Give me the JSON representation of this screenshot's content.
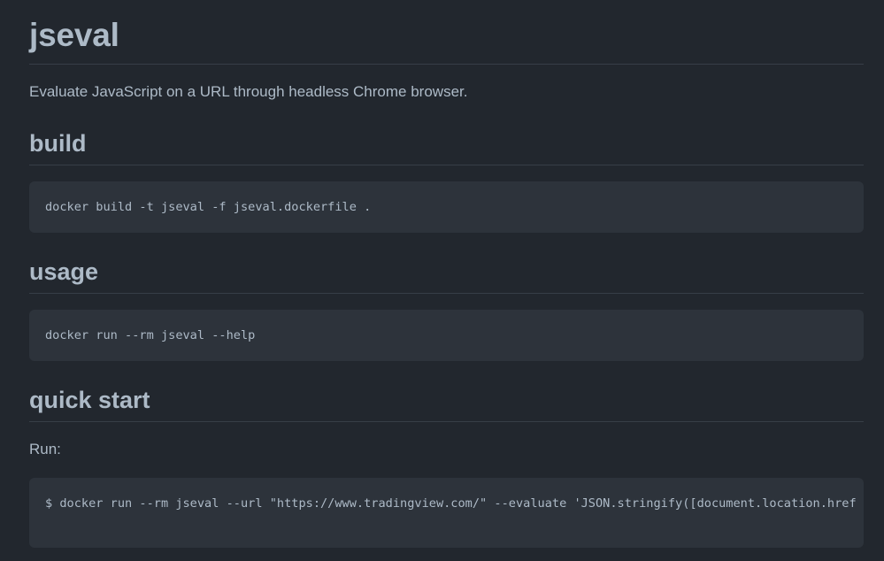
{
  "title": "jseval",
  "description": "Evaluate JavaScript on a URL through headless Chrome browser.",
  "sections": {
    "build": {
      "heading": "build",
      "code": "docker build -t jseval -f jseval.dockerfile ."
    },
    "usage": {
      "heading": "usage",
      "code": "docker run --rm jseval --help"
    },
    "quick_start": {
      "heading": "quick start",
      "intro": "Run:",
      "code": "$ docker run --rm jseval --url \"https://www.tradingview.com/\" --evaluate 'JSON.stringify([document.location.href"
    }
  },
  "colors": {
    "background": "#22272e",
    "code_background": "#2d333b",
    "text": "#adbac7",
    "divider": "#373e47"
  }
}
